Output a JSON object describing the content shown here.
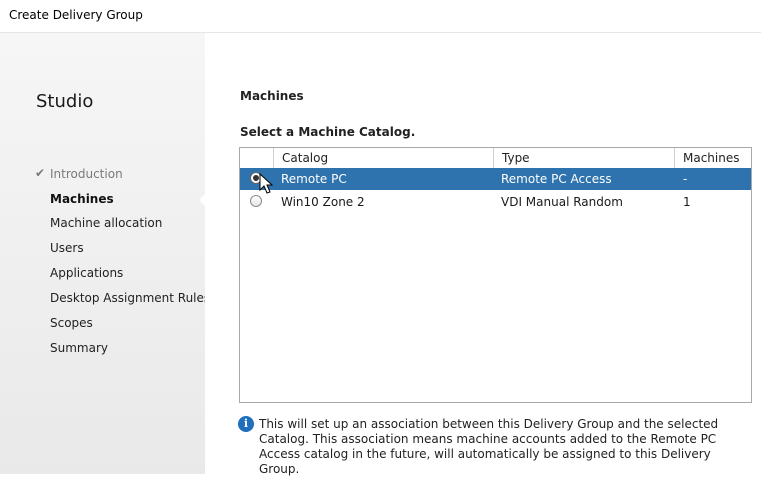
{
  "window": {
    "title": "Create Delivery Group"
  },
  "sidebar": {
    "heading": "Studio",
    "items": [
      {
        "label": "Introduction",
        "state": "done"
      },
      {
        "label": "Machines",
        "state": "active"
      },
      {
        "label": "Machine allocation",
        "state": "pending"
      },
      {
        "label": "Users",
        "state": "pending"
      },
      {
        "label": "Applications",
        "state": "pending"
      },
      {
        "label": "Desktop Assignment Rules",
        "state": "pending"
      },
      {
        "label": "Scopes",
        "state": "pending"
      },
      {
        "label": "Summary",
        "state": "pending"
      }
    ],
    "check_glyph": "✔"
  },
  "main": {
    "section_title": "Machines",
    "select_label": "Select a Machine Catalog.",
    "table": {
      "columns": [
        "Catalog",
        "Type",
        "Machines"
      ],
      "rows": [
        {
          "catalog": "Remote PC",
          "type": "Remote PC Access",
          "machines": "-",
          "selected": true
        },
        {
          "catalog": "Win10 Zone 2",
          "type": "VDI Manual Random",
          "machines": "1",
          "selected": false
        }
      ]
    },
    "info": {
      "icon": "i",
      "text": "This will set up an association between this Delivery Group and the selected Catalog. This association means machine accounts added to the Remote PC Access catalog in the future, will automatically be assigned to this Delivery Group."
    }
  },
  "colors": {
    "selection": "#2e73ad",
    "info_icon": "#1f6fbf"
  }
}
